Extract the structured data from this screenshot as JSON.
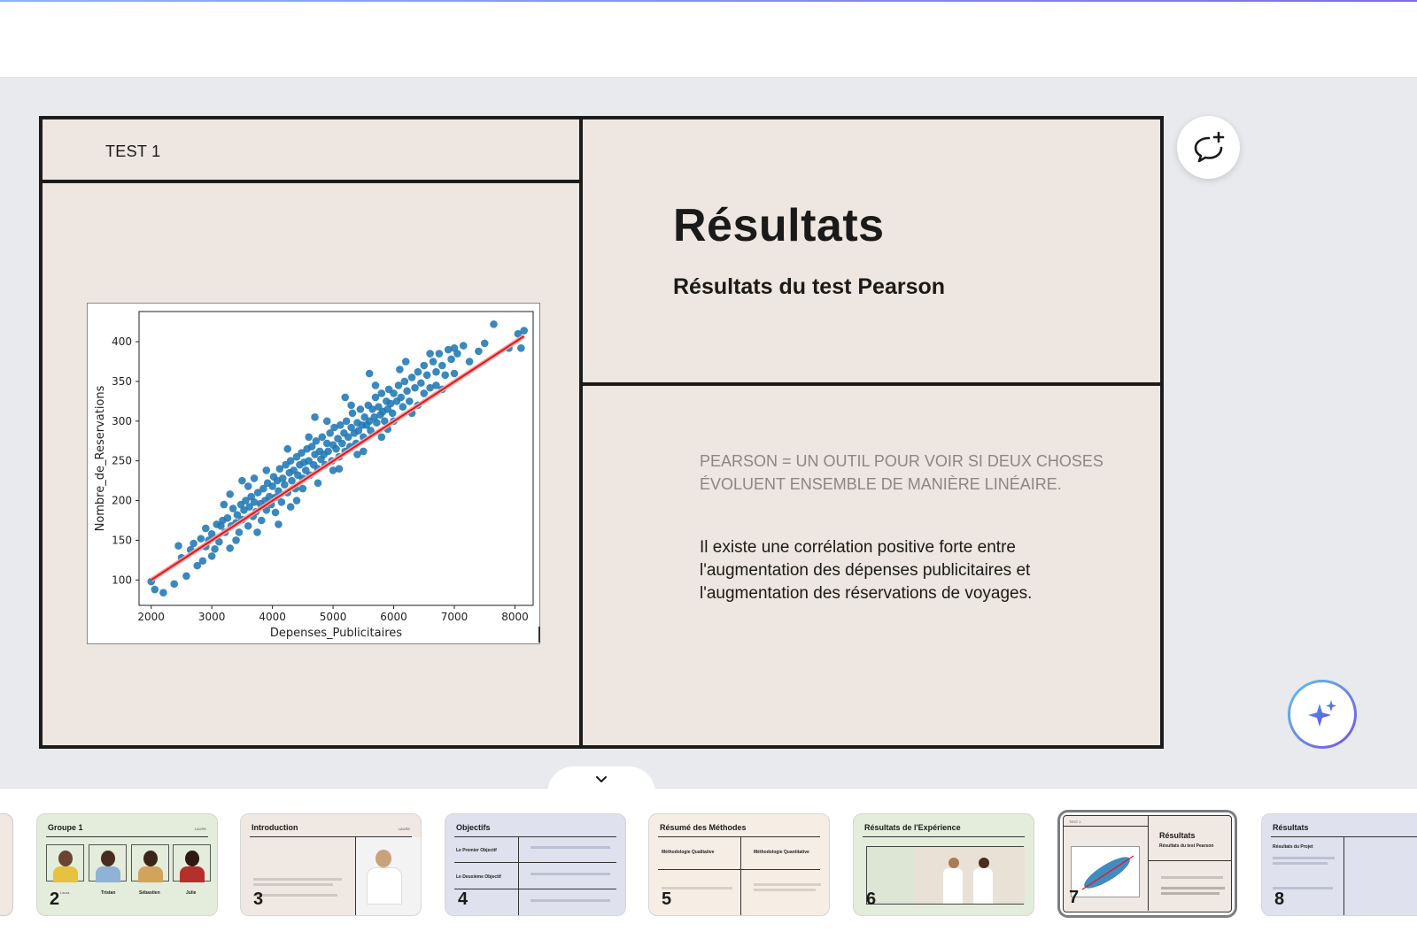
{
  "slide": {
    "test_label": "TEST 1",
    "title": "Résultats",
    "subtitle": "Résultats du test Pearson",
    "pearson_definition": "PEARSON = UN OUTIL POUR VOIR SI DEUX CHOSES ÉVOLUENT ENSEMBLE DE MANIÈRE LINÉAIRE.",
    "conclusion": "Il existe une corrélation positive forte entre l'augmentation des dépenses publicitaires et l'augmentation des réservations de voyages."
  },
  "chart_data": {
    "type": "scatter",
    "xlabel": "Depenses_Publicitaires",
    "ylabel": "Nombre_de_Reservations",
    "xlim": [
      1800,
      8300
    ],
    "ylim": [
      68,
      438
    ],
    "xticks": [
      2000,
      3000,
      4000,
      5000,
      6000,
      7000,
      8000
    ],
    "yticks": [
      100,
      150,
      200,
      250,
      300,
      350,
      400
    ],
    "regression_line": {
      "x": [
        2000,
        8150
      ],
      "y": [
        100,
        407
      ],
      "color": "#e8141c"
    },
    "point_color": "#1f77b4",
    "series": [
      {
        "points": [
          [
            2000,
            98
          ],
          [
            2060,
            88
          ],
          [
            2200,
            84
          ],
          [
            2380,
            95
          ],
          [
            2450,
            143
          ],
          [
            2500,
            128
          ],
          [
            2580,
            105
          ],
          [
            2650,
            138
          ],
          [
            2700,
            146
          ],
          [
            2760,
            118
          ],
          [
            2820,
            152
          ],
          [
            2850,
            124
          ],
          [
            2900,
            142
          ],
          [
            2950,
            150
          ],
          [
            3000,
            158
          ],
          [
            3050,
            139
          ],
          [
            3080,
            170
          ],
          [
            3120,
            148
          ],
          [
            3150,
            168
          ],
          [
            3180,
            175
          ],
          [
            3220,
            160
          ],
          [
            3260,
            178
          ],
          [
            3300,
            140
          ],
          [
            3320,
            168
          ],
          [
            3350,
            190
          ],
          [
            3400,
            172
          ],
          [
            3420,
            182
          ],
          [
            3450,
            160
          ],
          [
            3480,
            195
          ],
          [
            3500,
            176
          ],
          [
            3530,
            188
          ],
          [
            3560,
            200
          ],
          [
            3600,
            168
          ],
          [
            3620,
            192
          ],
          [
            3650,
            205
          ],
          [
            3680,
            180
          ],
          [
            3700,
            198
          ],
          [
            3730,
            186
          ],
          [
            3760,
            210
          ],
          [
            3800,
            196
          ],
          [
            3820,
            175
          ],
          [
            3850,
            215
          ],
          [
            3880,
            200
          ],
          [
            3900,
            188
          ],
          [
            3920,
            222
          ],
          [
            3950,
            205
          ],
          [
            3980,
            195
          ],
          [
            4000,
            218
          ],
          [
            4020,
            230
          ],
          [
            4050,
            204
          ],
          [
            4080,
            225
          ],
          [
            4100,
            212
          ],
          [
            4120,
            240
          ],
          [
            4150,
            198
          ],
          [
            4170,
            228
          ],
          [
            4200,
            220
          ],
          [
            4220,
            245
          ],
          [
            4250,
            210
          ],
          [
            4280,
            235
          ],
          [
            4300,
            250
          ],
          [
            4320,
            225
          ],
          [
            4350,
            238
          ],
          [
            4380,
            215
          ],
          [
            4400,
            255
          ],
          [
            4420,
            232
          ],
          [
            4450,
            245
          ],
          [
            4480,
            260
          ],
          [
            4500,
            228
          ],
          [
            4520,
            248
          ],
          [
            4550,
            238
          ],
          [
            4570,
            265
          ],
          [
            4600,
            250
          ],
          [
            4620,
            232
          ],
          [
            4650,
            268
          ],
          [
            4680,
            245
          ],
          [
            4700,
            258
          ],
          [
            4720,
            275
          ],
          [
            4750,
            240
          ],
          [
            4780,
            262
          ],
          [
            4800,
            252
          ],
          [
            4820,
            280
          ],
          [
            4850,
            258
          ],
          [
            4870,
            245
          ],
          [
            4900,
            272
          ],
          [
            4920,
            262
          ],
          [
            4950,
            285
          ],
          [
            4980,
            250
          ],
          [
            5000,
            270
          ],
          [
            5020,
            292
          ],
          [
            5050,
            265
          ],
          [
            5080,
            278
          ],
          [
            5100,
            255
          ],
          [
            5120,
            295
          ],
          [
            5150,
            272
          ],
          [
            5180,
            285
          ],
          [
            5200,
            262
          ],
          [
            5220,
            300
          ],
          [
            5250,
            280
          ],
          [
            5280,
            268
          ],
          [
            5300,
            292
          ],
          [
            5320,
            310
          ],
          [
            5350,
            285
          ],
          [
            5380,
            272
          ],
          [
            5400,
            298
          ],
          [
            5420,
            288
          ],
          [
            5450,
            315
          ],
          [
            5480,
            295
          ],
          [
            5500,
            280
          ],
          [
            5520,
            305
          ],
          [
            5550,
            295
          ],
          [
            5580,
            320
          ],
          [
            5600,
            300
          ],
          [
            5620,
            288
          ],
          [
            5650,
            315
          ],
          [
            5680,
            305
          ],
          [
            5700,
            330
          ],
          [
            5720,
            298
          ],
          [
            5750,
            318
          ],
          [
            5780,
            308
          ],
          [
            5800,
            335
          ],
          [
            5820,
            312
          ],
          [
            5850,
            300
          ],
          [
            5880,
            325
          ],
          [
            5900,
            315
          ],
          [
            5920,
            340
          ],
          [
            5950,
            322
          ],
          [
            5980,
            310
          ],
          [
            6000,
            335
          ],
          [
            6050,
            325
          ],
          [
            6080,
            345
          ],
          [
            6120,
            330
          ],
          [
            6150,
            318
          ],
          [
            6180,
            350
          ],
          [
            6220,
            338
          ],
          [
            6260,
            325
          ],
          [
            6300,
            355
          ],
          [
            6350,
            342
          ],
          [
            6400,
            362
          ],
          [
            6450,
            348
          ],
          [
            6500,
            370
          ],
          [
            6550,
            358
          ],
          [
            6600,
            342
          ],
          [
            6650,
            375
          ],
          [
            6700,
            362
          ],
          [
            6750,
            385
          ],
          [
            6800,
            370
          ],
          [
            6850,
            358
          ],
          [
            6900,
            390
          ],
          [
            6950,
            378
          ],
          [
            7000,
            392
          ],
          [
            7050,
            385
          ],
          [
            7150,
            395
          ],
          [
            7250,
            375
          ],
          [
            7400,
            388
          ],
          [
            7500,
            398
          ],
          [
            7650,
            422
          ],
          [
            7900,
            392
          ],
          [
            8050,
            410
          ],
          [
            8100,
            392
          ],
          [
            8150,
            414
          ],
          [
            3200,
            195
          ],
          [
            3400,
            150
          ],
          [
            3600,
            218
          ],
          [
            3750,
            160
          ],
          [
            3900,
            238
          ],
          [
            4050,
            185
          ],
          [
            4250,
            265
          ],
          [
            4400,
            200
          ],
          [
            4600,
            280
          ],
          [
            4750,
            222
          ],
          [
            4900,
            300
          ],
          [
            5100,
            240
          ],
          [
            5300,
            320
          ],
          [
            5500,
            262
          ],
          [
            5700,
            345
          ],
          [
            5900,
            290
          ],
          [
            6100,
            365
          ],
          [
            6300,
            310
          ],
          [
            6500,
            335
          ],
          [
            6700,
            345
          ],
          [
            3000,
            130
          ],
          [
            2900,
            165
          ],
          [
            3300,
            208
          ],
          [
            3500,
            225
          ],
          [
            3700,
            228
          ],
          [
            4100,
            170
          ],
          [
            4300,
            192
          ],
          [
            4500,
            215
          ],
          [
            4700,
            305
          ],
          [
            5000,
            238
          ],
          [
            5200,
            330
          ],
          [
            5400,
            258
          ],
          [
            5600,
            360
          ],
          [
            5800,
            280
          ],
          [
            6000,
            300
          ],
          [
            6200,
            375
          ],
          [
            6400,
            320
          ],
          [
            6600,
            385
          ],
          [
            6800,
            340
          ],
          [
            7000,
            360
          ]
        ]
      }
    ]
  },
  "buttons": {
    "comment": "comment-add-icon",
    "magic": "sparkles-icon",
    "collapse": "chevron-down-icon"
  },
  "thumbnails": [
    {
      "num": "2",
      "title": "Groupe 1",
      "bg": "#e4ecdc",
      "people": [
        "Laura",
        "Tristan",
        "Sébastien",
        "Julie"
      ],
      "corner": "LAURE"
    },
    {
      "num": "3",
      "title": "Introduction",
      "bg": "#efe8e3",
      "corner": "LAURE"
    },
    {
      "num": "4",
      "title": "Objectifs",
      "bg": "#dfe1ee",
      "rows": [
        "Le Premier Objectif",
        "Le Deuxième Objectif"
      ]
    },
    {
      "num": "5",
      "title": "Résumé des Méthodes",
      "bg": "#f6ede4",
      "cols": [
        "Méthodologie Qualitative",
        "Méthodologie Quantitative"
      ]
    },
    {
      "num": "6",
      "title": "Résultats de l'Expérience",
      "bg": "#e4ecdc"
    },
    {
      "num": "7",
      "title": "Résultats",
      "sub": "Résultats du test Pearson",
      "bg": "#efe8e3",
      "corner": "TEST 1"
    },
    {
      "num": "8",
      "title": "Résultats",
      "sub": "Résultats du Projet",
      "bg": "#dfe1ee"
    }
  ]
}
